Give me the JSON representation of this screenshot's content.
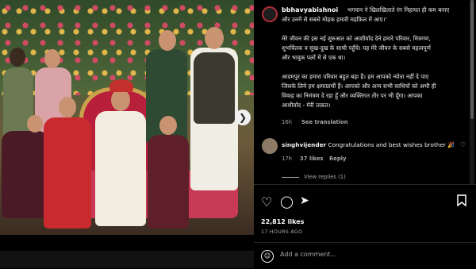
{
  "post": {
    "caption": {
      "username": "bbhavyabishnoi",
      "lines": [
        "भगवान ने खिलखिलाते रंग निहायत ही कम बनाए",
        "और उनमें से सबसे मोहक हमारी महफ़िल में आए।'",
        "",
        "मेरे जीवन की इस नई शुरुआत को आशीर्वाद देने हमारे परिवार, मित्रगण,",
        "शुभचिंतक व सुख-दुख के साथी पहुँचे। यह मेरे जीवन के सबसे महत्वपूर्ण",
        "और भावुक पलों में से एक था।",
        "",
        "आदमपुर का हमारा परिवार बहुत बड़ा है। हम आपको न्योता नहीं दे पाए",
        "जिसके लिये हम क्षमाप्रार्थी हैं। आपको और अन्य सभी साथियों को अभी ही",
        "विवाह का निमंत्रण दे रहा हूँ और व्यक्तिगत तौर पर भी दूँगा। आपका",
        "आशीर्वाद - मेरी ताक़त।"
      ],
      "time": "16h",
      "see_translation": "See translation"
    },
    "comment": {
      "username": "singhvijender",
      "text": "Congratulations and best wishes brother 🎉",
      "time": "17h",
      "likes": "37 likes",
      "reply": "Reply",
      "view_replies": "View replies (1)"
    },
    "likes": "22,812 likes",
    "posted": "17 HOURS AGO",
    "add_comment_placeholder": "Add a comment..."
  },
  "icons": {
    "like": "heart-icon",
    "comment": "comment-bubble-icon",
    "share": "paper-plane-icon",
    "save": "bookmark-icon",
    "emoji": "smile-icon",
    "next": "chevron-right-icon"
  }
}
